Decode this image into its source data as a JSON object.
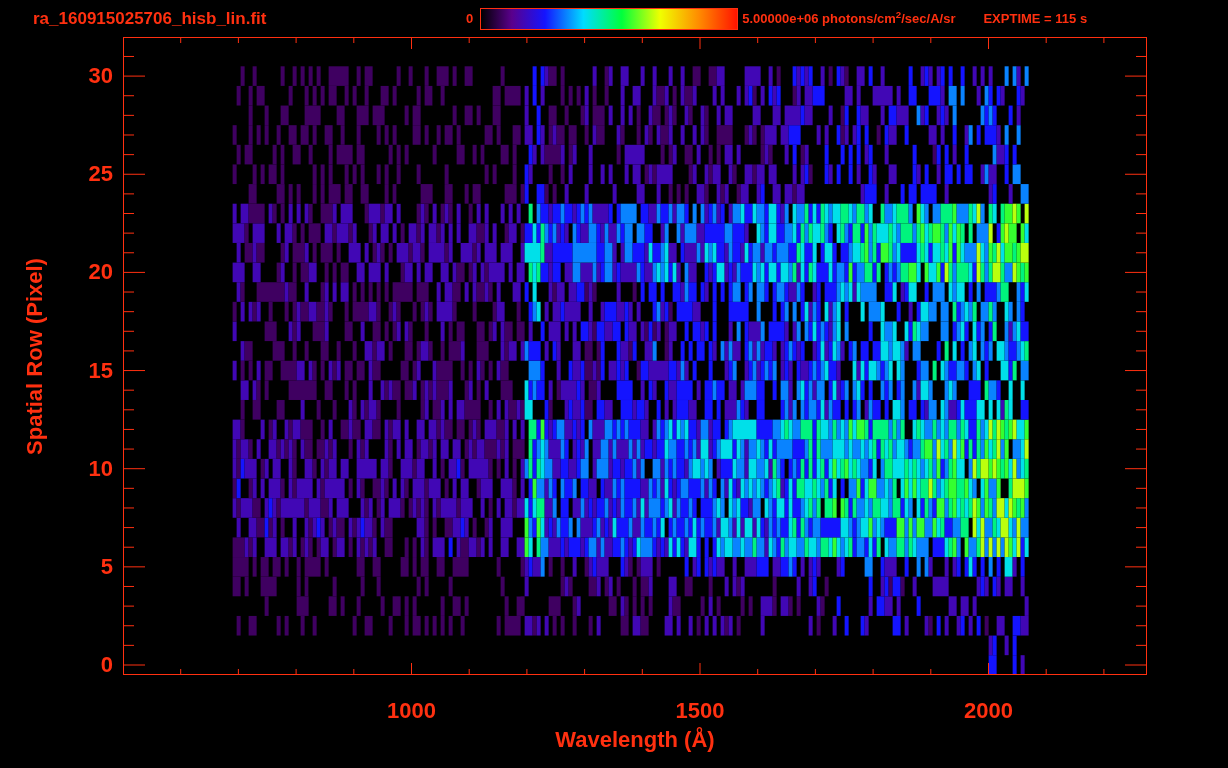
{
  "header": {
    "filename": "ra_160915025706_hisb_lin.fit",
    "colorbar": {
      "min_label": "0",
      "max_label": "5.00000e+06 photons/cm$^{2}$/sec/A/sr"
    },
    "exposure": "EXPTIME = 115 s"
  },
  "plot": {
    "x_axis": {
      "title": "Wavelength (Å)",
      "ticks": [
        "1000",
        "1500",
        "2000"
      ]
    },
    "y_axis": {
      "title": "Spatial Row (Pixel)",
      "ticks": [
        "30",
        "25",
        "20",
        "15",
        "10",
        "5",
        "0"
      ]
    }
  }
}
